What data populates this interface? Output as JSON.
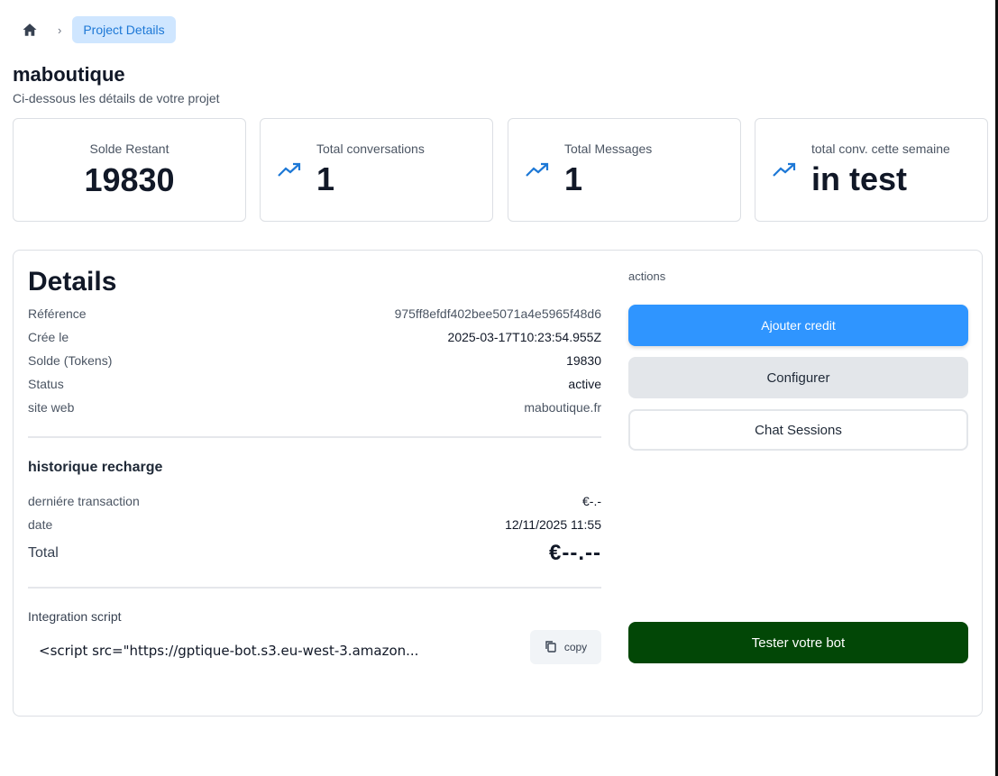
{
  "breadcrumb": {
    "home_icon": "home-icon",
    "separator": "›",
    "current": "Project Details"
  },
  "project": {
    "title": "maboutique",
    "subtitle": "Ci-dessous les détails de votre projet"
  },
  "stats": [
    {
      "label": "Solde Restant",
      "value": "19830"
    },
    {
      "label": "Total conversations",
      "value": "1",
      "icon": "trending-up-icon"
    },
    {
      "label": "Total Messages",
      "value": "1",
      "icon": "trending-up-icon"
    },
    {
      "label": "total conv. cette semaine",
      "value": "in test",
      "icon": "trending-up-icon"
    }
  ],
  "details": {
    "title": "Details",
    "rows": [
      {
        "key": "Référence",
        "value": "975ff8efdf402bee5071a4e5965f48d6"
      },
      {
        "key": "Crée le",
        "value": "2025-03-17T10:23:54.955Z"
      },
      {
        "key": "Solde (Tokens)",
        "value": "19830"
      },
      {
        "key": "Status",
        "value": "active"
      },
      {
        "key": "site web",
        "value": "maboutique.fr"
      }
    ]
  },
  "recharge": {
    "title": "historique recharge",
    "last_transaction_label": "derniére transaction",
    "last_transaction_value": "€-.-",
    "date_label": "date",
    "date_value": "12/11/2025 11:55",
    "total_label": "Total",
    "total_value": "€--.--"
  },
  "integration": {
    "label": "Integration script",
    "code": "<script src=\"https://gptique-bot.s3.eu-west-3.amazon...",
    "copy_label": "copy",
    "copy_icon": "copy-icon"
  },
  "actions": {
    "label": "actions",
    "add_credit": "Ajouter credit",
    "configure": "Configurer",
    "chat_sessions": "Chat Sessions",
    "test_bot": "Tester votre bot"
  },
  "colors": {
    "primary": "#2f95ff",
    "dark_green": "#024706",
    "chip_bg": "#cfe6ff",
    "chip_text": "#1d78d6",
    "trend_icon": "#1d78d6"
  }
}
